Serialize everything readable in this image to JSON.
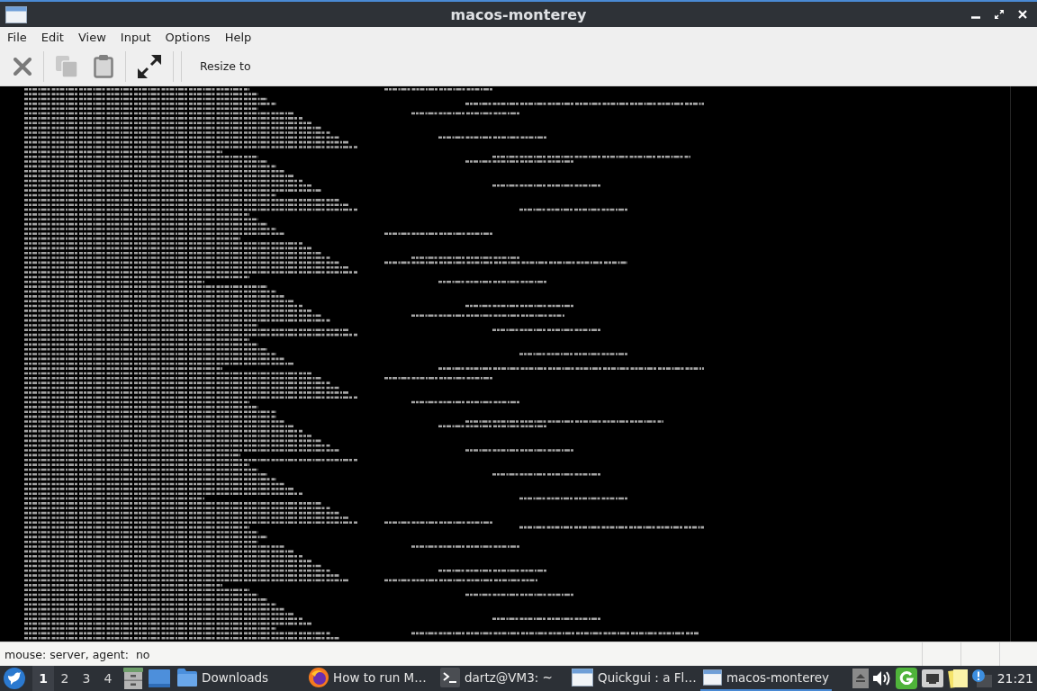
{
  "window": {
    "title": "macos-monterey"
  },
  "menu": [
    {
      "label": "File"
    },
    {
      "label": "Edit"
    },
    {
      "label": "View"
    },
    {
      "label": "Input"
    },
    {
      "label": "Options"
    },
    {
      "label": "Help"
    }
  ],
  "toolbar": [
    {
      "kind": "close",
      "disabled": false
    },
    {
      "kind": "copy",
      "disabled": true
    },
    {
      "kind": "paste",
      "disabled": false
    },
    {
      "kind": "fullscreen",
      "disabled": false
    },
    {
      "kind": "text",
      "label": "Resize to",
      "disabled": false
    }
  ],
  "status_bar": {
    "text": "mouse: server, agent:  no"
  },
  "taskbar": {
    "workspaces": [
      {
        "label": "1",
        "selected": true
      },
      {
        "label": "2",
        "selected": false
      },
      {
        "label": "3",
        "selected": false
      },
      {
        "label": "4",
        "selected": false
      }
    ],
    "tasks": [
      {
        "kind": "folder",
        "label": "Downloads",
        "selected": false
      },
      {
        "kind": "browser",
        "label": "How to run M…",
        "selected": false
      },
      {
        "kind": "terminal",
        "label": "dartz@VM3: ~",
        "selected": false
      },
      {
        "kind": "window",
        "label": "Quickgui : a Fl…",
        "selected": false
      },
      {
        "kind": "window",
        "label": "macos-monterey",
        "selected": true
      }
    ],
    "clock": "21:21"
  }
}
